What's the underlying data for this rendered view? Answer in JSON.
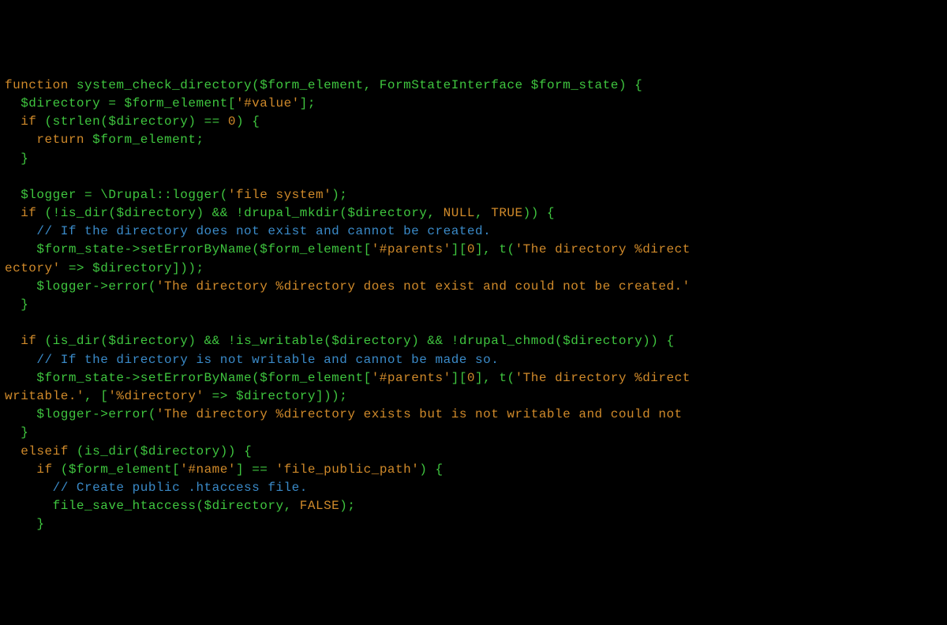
{
  "code": {
    "l01": {
      "a": "function ",
      "b": "system_check_directory",
      "c": "(",
      "d": "$form_element",
      "e": ", ",
      "f": "FormStateInterface ",
      "g": "$form_state",
      "h": ") {"
    },
    "l02": {
      "a": "  ",
      "b": "$directory",
      "c": " = ",
      "d": "$form_element",
      "e": "[",
      "f": "'#value'",
      "g": "];"
    },
    "l03": {
      "a": "  ",
      "b": "if ",
      "c": "(",
      "d": "strlen",
      "e": "(",
      "f": "$directory",
      "g": ") == ",
      "h": "0",
      "i": ") {"
    },
    "l04": {
      "a": "    ",
      "b": "return ",
      "c": "$form_element",
      "d": ";"
    },
    "l05": {
      "a": "  }"
    },
    "l06": {
      "a": " "
    },
    "l07": {
      "a": "  ",
      "b": "$logger",
      "c": " = \\Drupal::",
      "d": "logger",
      "e": "(",
      "f": "'file system'",
      "g": ");"
    },
    "l08": {
      "a": "  ",
      "b": "if ",
      "c": "(!",
      "d": "is_dir",
      "e": "(",
      "f": "$directory",
      "g": ") && !",
      "h": "drupal_mkdir",
      "i": "(",
      "j": "$directory",
      "k": ", ",
      "l": "NULL",
      "m": ", ",
      "n": "TRUE",
      "o": ")) {"
    },
    "l09": {
      "a": "    ",
      "b": "// If the directory does not exist and cannot be created."
    },
    "l10": {
      "a": "    ",
      "b": "$form_state",
      "c": "->",
      "d": "setErrorByName",
      "e": "(",
      "f": "$form_element",
      "g": "[",
      "h": "'#parents'",
      "i": "][",
      "j": "0",
      "k": "], ",
      "l": "t",
      "m": "(",
      "n": "'The directory %direct"
    },
    "l10w": {
      "a": "ectory'",
      "b": " => ",
      "c": "$directory",
      "d": "]));"
    },
    "l11": {
      "a": "    ",
      "b": "$logger",
      "c": "->",
      "d": "error",
      "e": "(",
      "f": "'The directory %directory does not exist and could not be created.'"
    },
    "l12": {
      "a": "  }"
    },
    "l13": {
      "a": " "
    },
    "l14": {
      "a": "  ",
      "b": "if ",
      "c": "(",
      "d": "is_dir",
      "e": "(",
      "f": "$directory",
      "g": ") && !",
      "h": "is_writable",
      "i": "(",
      "j": "$directory",
      "k": ") && !",
      "l": "drupal_chmod",
      "m": "(",
      "n": "$directory",
      "o": ")) {"
    },
    "l15": {
      "a": "    ",
      "b": "// If the directory is not writable and cannot be made so."
    },
    "l16": {
      "a": "    ",
      "b": "$form_state",
      "c": "->",
      "d": "setErrorByName",
      "e": "(",
      "f": "$form_element",
      "g": "[",
      "h": "'#parents'",
      "i": "][",
      "j": "0",
      "k": "], ",
      "l": "t",
      "m": "(",
      "n": "'The directory %direct"
    },
    "l16w": {
      "a": "writable.'",
      "b": ", [",
      "c": "'%directory'",
      "d": " => ",
      "e": "$directory",
      "f": "]));"
    },
    "l17": {
      "a": "    ",
      "b": "$logger",
      "c": "->",
      "d": "error",
      "e": "(",
      "f": "'The directory %directory exists but is not writable and could not "
    },
    "l18": {
      "a": "  }"
    },
    "l19": {
      "a": "  ",
      "b": "elseif ",
      "c": "(",
      "d": "is_dir",
      "e": "(",
      "f": "$directory",
      "g": ")) {"
    },
    "l20": {
      "a": "    ",
      "b": "if ",
      "c": "(",
      "d": "$form_element",
      "e": "[",
      "f": "'#name'",
      "g": "] == ",
      "h": "'file_public_path'",
      "i": ") {"
    },
    "l21": {
      "a": "      ",
      "b": "// Create public .htaccess file."
    },
    "l22": {
      "a": "      ",
      "b": "file_save_htaccess",
      "c": "(",
      "d": "$directory",
      "e": ", ",
      "f": "FALSE",
      "g": ");"
    },
    "l23": {
      "a": "    }"
    }
  }
}
